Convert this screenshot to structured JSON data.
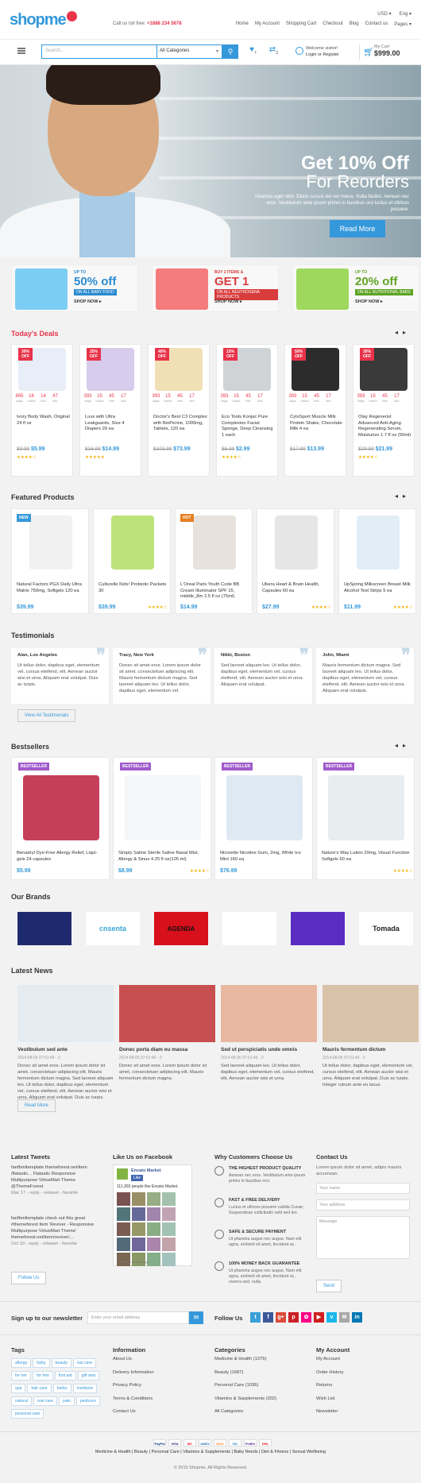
{
  "header": {
    "logo": "shopme",
    "tollfree_label": "Call us toll free:",
    "tollfree_number": "+1888 234 5678",
    "currency": "USD ▾",
    "language": "Eng ▾",
    "links": [
      "Home",
      "My Account",
      "Shopping Cart",
      "Checkout",
      "Blog",
      "Contact us",
      "Pages ▾"
    ]
  },
  "search": {
    "placeholder": "Search...",
    "category": "All Categories",
    "wishlist_count": "7",
    "compare_count": "3",
    "welcome": "Welcome visitor!",
    "login": "Login or Register",
    "cart_label": "My Cart",
    "cart_total": "$999.00"
  },
  "hero": {
    "title": "Get 10% Off",
    "subtitle": "For Reorders",
    "text": "Vivamus eget nibh. Etiam cursus leo vel metus. Nulla facilisi. Aenean nec eros. Vestibulum ante ipsum primis in faucibus orci luctus et ultrices posuere.",
    "button": "Read More"
  },
  "promos": [
    {
      "t1": "UP TO",
      "t2": "50% off",
      "t3": "ON ALL BABY FOOD",
      "t4": "SHOP NOW ▸",
      "bg": "#7ccdf3",
      "tagbg": "#2b8bd0",
      "img": "mashups"
    },
    {
      "t1": "BUY 2 ITEMS &",
      "t2": "GET 1 FREE",
      "t3": "ON ALL NEUTROGENA PRODUCTS",
      "t4": "SHOP NOW ▸",
      "bg": "#f47c7c",
      "tagbg": "#d83c3c",
      "img": "neutrogena"
    },
    {
      "t1": "UP TO",
      "t2": "20% off",
      "t3": "ON ALL NUTRITIONAL BARS",
      "t4": "SHOP NOW ▸",
      "bg": "#9ed85c",
      "tagbg": "#5fa325",
      "img": "fullbar"
    }
  ],
  "deals": {
    "title": "Today's Deals",
    "timer_labels": [
      "days",
      "hours",
      "min",
      "sec"
    ],
    "items": [
      {
        "badge": "30% OFF",
        "timer": [
          "665",
          "16",
          "14",
          "47"
        ],
        "name": "Ivory Body Wash, Original 24 fl oz",
        "old": "$9.99",
        "new": "$5.99",
        "stars": "★★★★☆"
      },
      {
        "badge": "25% OFF",
        "timer": [
          "393",
          "15",
          "45",
          "17"
        ],
        "name": "Luvs with Ultra Leakguards, Size 4 Diapers 29 ea",
        "old": "",
        "new": "$14.99",
        "stars": "★★★★★"
      },
      {
        "badge": "40% OFF",
        "timer": [
          "393",
          "15",
          "45",
          "17"
        ],
        "name": "Doctor's Best C3 Complex with BioPerine, 1000mg, Tablets, 120 ea",
        "old": "$103.99",
        "new": "$73.99",
        "stars": ""
      },
      {
        "badge": "15% OFF",
        "timer": [
          "393",
          "15",
          "45",
          "17"
        ],
        "name": "Eco Tools Konjac Pure Complexion Facial Sponge, Deep Cleansing 1 each",
        "old": "$5.99",
        "new": "$2.99",
        "stars": "★★★★☆"
      },
      {
        "badge": "50% OFF",
        "timer": [
          "393",
          "15",
          "45",
          "17"
        ],
        "name": "CytoSport Muscle Milk Protein Shake, Chocolate Milk 4 ea",
        "old": "",
        "new": "$13.99",
        "stars": ""
      },
      {
        "badge": "30% OFF",
        "timer": [
          "393",
          "15",
          "45",
          "17"
        ],
        "name": "Olay Regenerist Advanced Anti-Aging Regenerating Serum, Moisturize 1.7 fl oz (50ml)",
        "old": "",
        "new": "$21.99",
        "stars": "★★★★☆"
      }
    ],
    "old_prices_extra": {
      "1": "$16.99",
      "4": "$17.99",
      "5": "$29.99"
    }
  },
  "featured": {
    "title": "Featured Products",
    "items": [
      {
        "badge": "NEW",
        "name": "Natural Factors PGX Daily Ultra Matrix 750mg, Softgels 120 ea",
        "price": "$39.99",
        "stars": ""
      },
      {
        "badge": "",
        "name": "Culturelle Kids! Probiotic Packets 30",
        "price": "$39.99",
        "stars": "★★★★☆"
      },
      {
        "badge": "HOT",
        "name": "L'Oreal Paris Youth Code BB Cream Illuminator SPF 15, middle_8m 2.5 fl oz (75ml)",
        "price": "$14.99",
        "stars": ""
      },
      {
        "badge": "",
        "name": "Ubera Heart & Brain Health, Capsules 60 ea",
        "price": "$27.99",
        "stars": "★★★★☆"
      },
      {
        "badge": "",
        "name": "UpSpring Milkscreen Breast Milk Alcohol Test Strips 5 ea",
        "price": "$11.99",
        "stars": "★★★★☆"
      }
    ]
  },
  "testimonials": {
    "title": "Testimonials",
    "button": "View All Testimonials",
    "items": [
      {
        "who": "Alan, Los Angeles",
        "txt": "Ut tellus dolor, dapibus eget, elementum vel, cursus eleifend, elit. Aenean auctor wisi et urna. Aliquam erat volutpat. Duis ac turpis."
      },
      {
        "who": "Tracy, New York",
        "txt": "Donec sit amet eros. Lorem ipsum dolor sit amet, consectetuer adipiscing elit. Mauris fermentum dictum magna. Sed laoreet aliquam leo. Ut tellus dolor, dapibus eget, elementum vel."
      },
      {
        "who": "Nikki, Boston",
        "txt": "Sed laoreet aliquam leo. Ut tellus dolor, dapibus eget, elementum vel, cursus eleifend, elit. Aenean auctor wisi et urna. Aliquam erat volutpat."
      },
      {
        "who": "John, Miami",
        "txt": "Mauris fermentum dictum magna. Sed laoreet aliquam leo. Ut tellus dolor, dapibus eget, elementum vel, cursus eleifend, elit. Aenean auctor wisi et urna. Aliquam erat volutpat."
      }
    ]
  },
  "bestsellers": {
    "title": "Bestsellers",
    "badge": "BESTSELLER",
    "items": [
      {
        "name": "Benadryl Dye-Free Allergy Relief, Liqui-gels 24 capsules",
        "price": "$5.99",
        "stars": ""
      },
      {
        "name": "Simply Saline Sterile Saline Nasal Mist, Allergy & Sinus 4.25 fl oz(126 ml)",
        "price": "$8.99",
        "stars": "★★★★☆"
      },
      {
        "name": "Nicorette Nicotine Gum, 2mg, White Ice Mint 160 ea",
        "price": "$76.99",
        "stars": ""
      },
      {
        "name": "Nature's Way Lutein 20mg, Visual Function Softgels 60 ea",
        "price": "",
        "stars": "★★★★☆"
      }
    ]
  },
  "brands": {
    "title": "Our Brands",
    "items": [
      "",
      "cnsenta",
      "AGENDA",
      "",
      "",
      "Tomada"
    ]
  },
  "news": {
    "title": "Latest News",
    "button": "Read More",
    "items": [
      {
        "title": "Vestibulum sed ante",
        "meta": "2014-08-05 07:01:49  ·  0",
        "txt": "Donec sit amet eros. Lorem ipsum dolor sit amet, consectetuer adipiscing elit. Mauris fermentum dictum magna. Sed laoreet aliquam leo. Ut tellus dolor, dapibus eget, elementum vel, cursus eleifend, elit. Aenean auctor wisi et urna. Aliquam erat volutpat. Duis ac turpis."
      },
      {
        "title": "Donec porta diam eu massa",
        "meta": "2014-08-05 07:01:49  ·  0",
        "txt": "Donec sit amet eros. Lorem ipsum dolor sit amet, consectetuer adipiscing elit. Mauris fermentum dictum magna."
      },
      {
        "title": "Sed ut perspiciatis unde omnis",
        "meta": "2014-08-05 07:01:49  ·  0",
        "txt": "Sed laoreet aliquam leo. Ut tellus dolor, dapibus eget, elementum vel, cursus eleifend, elit. Aenean auctor wisi et urna."
      },
      {
        "title": "Mauris fermentum dictum",
        "meta": "2014-08-05 07:01:49  ·  0",
        "txt": "Ut tellus dolor, dapibus eget, elementum vel, cursus eleifend, elit. Aenean auctor wisi et urna. Aliquam erat volutpat. Duis ac turpis. Integer rutrum ante eu lacus."
      }
    ]
  },
  "footer": {
    "tweets": {
      "title": "Latest Tweets",
      "t1": "fanfbmltemplate themeforest.net/item /flatastic... Flatastic Responsive Multipurpose VirtueMart Theme @ThemeForest",
      "d1": "Mar 17 - reply - retweet - favorite",
      "t2": "fanfbmltemplate check out this great #themeforest item 'Reviver - Responsive Multipurpose VirtueMart Theme' themeforest.net/item/reviver/...",
      "d2": "Oct 10 - reply - retweet - favorite",
      "button": "Follow Us"
    },
    "facebook": {
      "title": "Like Us on Facebook",
      "page": "Envato Market",
      "like": "Like",
      "likes": "111,303 people like Envato Market.",
      "plugin": "Facebook social plugin"
    },
    "why": {
      "title": "Why Customers Choose Us",
      "items": [
        {
          "h": "THE HIGHEST PRODUCT QUALITY",
          "t": "Aenean nec eros. Vestibulum ante ipsum primis in faucibus orci."
        },
        {
          "h": "FAST & FREE DELIVERY",
          "t": "Luctus et ultrices posuere cubilia Curae; Suspendisse sollicitudin velit sed leo."
        },
        {
          "h": "SAFE & SECURE PAYMENT",
          "t": "Ut pharetra augue nec augue. Nam elit agna, endrerit sit amet, tincidunt ac."
        },
        {
          "h": "100% MONEY BACK GUARANTEE",
          "t": "Ut pharetra augue nec augue. Nam elit agna, endrerit sit amet, tincidunt ac, viverra sed, nulla."
        }
      ]
    },
    "contact": {
      "title": "Contact Us",
      "text": "Lorem ipsum dolor sit amet, adipis mauris accumsan.",
      "name_ph": "Your name",
      "email_ph": "Your address",
      "msg_ph": "Message",
      "send": "Send"
    },
    "newsletter": {
      "label": "Sign up to our newsletter",
      "placeholder": "Enter your email address"
    },
    "follow": {
      "label": "Follow Us",
      "icons": [
        {
          "g": "t",
          "c": "#3aa0d8"
        },
        {
          "g": "f",
          "c": "#3b5998"
        },
        {
          "g": "g+",
          "c": "#dc4a38"
        },
        {
          "g": "p",
          "c": "#cb2027"
        },
        {
          "g": "✿",
          "c": "#ff0084"
        },
        {
          "g": "▶",
          "c": "#cd201f"
        },
        {
          "g": "v",
          "c": "#1ab7ea"
        },
        {
          "g": "✉",
          "c": "#a8a8a8"
        },
        {
          "g": "in",
          "c": "#0077b5"
        }
      ]
    },
    "tags": {
      "title": "Tags",
      "items": [
        "allergy",
        "baby",
        "beauty",
        "ear care",
        "for her",
        "for him",
        "first aid",
        "gift sets",
        "spa",
        "hair care",
        "herbs",
        "medicine",
        "natural",
        "oral care",
        "pain",
        "pedicure",
        "personal care"
      ]
    },
    "information": {
      "title": "Information",
      "items": [
        "About Us",
        "Delivery Information",
        "Privacy Policy",
        "Terms & Conditions",
        "Contact Us"
      ]
    },
    "categories": {
      "title": "Categories",
      "items": [
        "Medicine & Health (1375)",
        "Beauty (1687)",
        "Personal Care (1036)",
        "Vitamins & Supplements (202)",
        "All Categories"
      ]
    },
    "account": {
      "title": "My Account",
      "items": [
        "My Account",
        "Order History",
        "Returns",
        "Wish List",
        "Newsletter"
      ]
    },
    "payments": [
      "PayPal",
      "VISA",
      "MC",
      "AMEX",
      "DISC",
      "DC",
      "FedEx",
      "DHL"
    ],
    "bottom_links": "Medicine & Health  |  Beauty  |  Personal Care  |  Vitamins & Supplements  |  Baby Needs  |  Diet & Fitness  |  Sexual Wellbeing",
    "copyright": "© 2015 Shopme. All Rights Reserved."
  }
}
